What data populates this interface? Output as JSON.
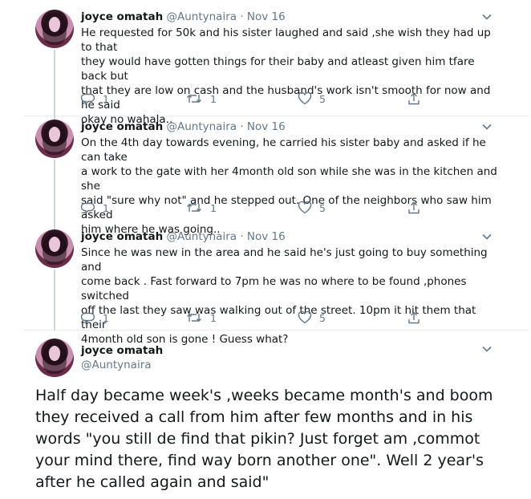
{
  "tweets": [
    {
      "name": "joyce omatah",
      "handle": "@Auntynaira",
      "separator": "·",
      "date": "Nov 16",
      "text": [
        "He requested for 50k and his sister laughed and said ,she wish they had up to that",
        "they would have gotten things for their baby and atleast given him tfare back but",
        "that they are low on cash and the husband's work isn't smooth for now and he said",
        "okay no wahala.."
      ],
      "replies": "1",
      "retweets": "1",
      "likes": "5"
    },
    {
      "name": "joyce omatah",
      "handle": "@Auntynaira",
      "separator": "·",
      "date": "Nov 16",
      "text": [
        "On the 4th  day towards evening, he carried his sister baby and asked if he can take",
        "a work to the gate with her 4month old son while she was in the kitchen and she",
        "said \"sure why not\" and he stepped out. One of the neighbors who saw him asked",
        "him where he was going.."
      ],
      "replies": "1",
      "retweets": "1",
      "likes": "5"
    },
    {
      "name": "joyce omatah",
      "handle": "@Auntynaira",
      "separator": "·",
      "date": "Nov 16",
      "text": [
        "Since he was new in the area and he said he's just going to buy something and",
        "come back . Fast forward to 7pm he was no where to be found ,phones switched",
        "off the last they saw was walking out of the street. 10pm it hit them that their",
        "4month old son is gone ! Guess what?"
      ],
      "replies": "1",
      "retweets": "1",
      "likes": "5"
    }
  ],
  "main_tweet": {
    "name": "joyce omatah",
    "handle": "@Auntynaira",
    "text": [
      "Half day became week's ,weeks became month's and boom",
      "they received a call from him after few months and in his",
      "words \"you still de find that pikin? Just forget am ,commot",
      "your mind there, find way born another one\". Well 2 year's",
      "after he called  again and said\""
    ]
  },
  "icons": {
    "reply": "reply-icon",
    "retweet": "retweet-icon",
    "like": "heart-icon",
    "share": "share-icon",
    "menu": "chevron-down-icon"
  },
  "colors": {
    "text": "#14171a",
    "muted": "#657786",
    "border": "#e6ecf0",
    "thread": "#ccd6dd"
  }
}
